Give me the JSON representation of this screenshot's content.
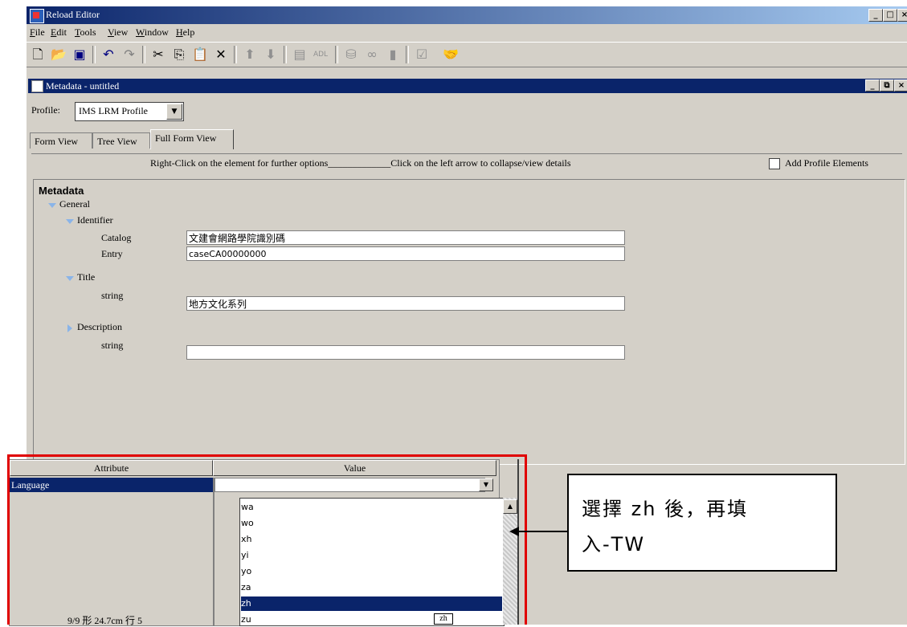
{
  "app": {
    "title": "Reload Editor"
  },
  "menu": {
    "items": [
      {
        "key": "F",
        "rest": "ile"
      },
      {
        "key": "E",
        "rest": "dit"
      },
      {
        "key": "T",
        "rest": "ools"
      },
      {
        "key": "V",
        "rest": "iew"
      },
      {
        "key": "W",
        "rest": "indow"
      },
      {
        "key": "H",
        "rest": "elp"
      }
    ]
  },
  "toolbar": {
    "icons": [
      "new-icon",
      "open-icon",
      "save-icon",
      "undo-icon",
      "redo-icon",
      "cut-icon",
      "copy-icon",
      "paste-icon",
      "delete-icon",
      "move-up-icon",
      "move-down-icon",
      "metadata-icon",
      "adl-icon",
      "package-icon",
      "preview-icon",
      "book-icon",
      "validate-icon",
      "handshake-icon"
    ],
    "adl_label": "ADL"
  },
  "inner_window": {
    "title": "Metadata - untitled"
  },
  "profile": {
    "label": "Profile:",
    "value": "IMS LRM Profile"
  },
  "tabs": [
    {
      "label": "Form View"
    },
    {
      "label": "Tree View"
    },
    {
      "label": "Full Form View"
    }
  ],
  "hint": {
    "text": "Right-Click on the element for further options_____________Click on the left arrow to collapse/view details",
    "checkbox_label": "Add Profile Elements"
  },
  "form": {
    "root": "Metadata",
    "general": "General",
    "identifier": "Identifier",
    "catalog_label": "Catalog",
    "catalog_value": "文建會網路學院識別碼",
    "entry_label": "Entry",
    "entry_value": "caseCA00000000",
    "title_label": "Title",
    "title_string_label": "string",
    "title_value": "地方文化系列",
    "description_label": "Description",
    "description_string_label": "string",
    "description_value": ""
  },
  "attributes": {
    "col_attribute": "Attribute",
    "col_value": "Value",
    "row_attribute": "Language",
    "row_value": "",
    "options": [
      "wa",
      "wo",
      "xh",
      "yi",
      "yo",
      "za",
      "zh",
      "zu"
    ],
    "selected": "zh"
  },
  "status": {
    "text": "9/9       形 24.7cm    行 5"
  },
  "ime": {
    "text": "zh"
  },
  "callout": {
    "line1": "選擇 zh 後，再填",
    "line2": "入-TW"
  }
}
